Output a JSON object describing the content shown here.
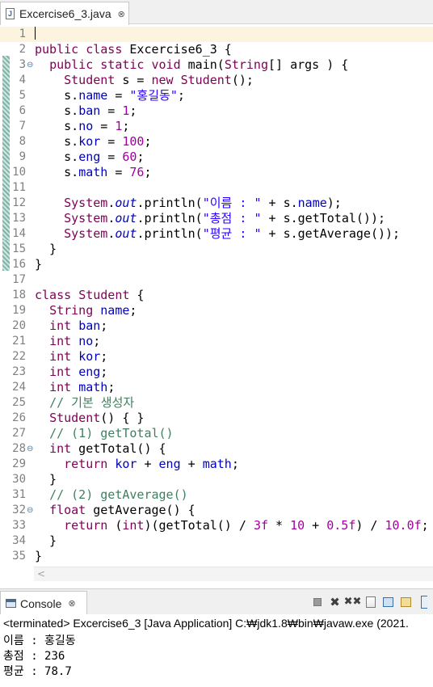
{
  "editor_tab": {
    "title": "Excercise6_3.java",
    "icon": "java-file-icon",
    "close": "⊗"
  },
  "editor": {
    "lines": [
      {
        "n": "1",
        "fold": "",
        "t": ""
      },
      {
        "n": "2",
        "fold": "",
        "t": "public class Excercise6_3 {"
      },
      {
        "n": "3",
        "fold": "⊖",
        "t": "  public static void main(String[] args ) {"
      },
      {
        "n": "4",
        "fold": "",
        "t": "    Student s = new Student();"
      },
      {
        "n": "5",
        "fold": "",
        "t": "    s.name = \"홍길동\";"
      },
      {
        "n": "6",
        "fold": "",
        "t": "    s.ban = 1;"
      },
      {
        "n": "7",
        "fold": "",
        "t": "    s.no = 1;"
      },
      {
        "n": "8",
        "fold": "",
        "t": "    s.kor = 100;"
      },
      {
        "n": "9",
        "fold": "",
        "t": "    s.eng = 60;"
      },
      {
        "n": "10",
        "fold": "",
        "t": "    s.math = 76;"
      },
      {
        "n": "11",
        "fold": "",
        "t": ""
      },
      {
        "n": "12",
        "fold": "",
        "t": "    System.out.println(\"이름 : \" + s.name);"
      },
      {
        "n": "13",
        "fold": "",
        "t": "    System.out.println(\"총점 : \" + s.getTotal());"
      },
      {
        "n": "14",
        "fold": "",
        "t": "    System.out.println(\"평균 : \" + s.getAverage());"
      },
      {
        "n": "15",
        "fold": "",
        "t": "  }"
      },
      {
        "n": "16",
        "fold": "",
        "t": "}"
      },
      {
        "n": "17",
        "fold": "",
        "t": ""
      },
      {
        "n": "18",
        "fold": "",
        "t": "class Student {"
      },
      {
        "n": "19",
        "fold": "",
        "t": "  String name;"
      },
      {
        "n": "20",
        "fold": "",
        "t": "  int ban;"
      },
      {
        "n": "21",
        "fold": "",
        "t": "  int no;"
      },
      {
        "n": "22",
        "fold": "",
        "t": "  int kor;"
      },
      {
        "n": "23",
        "fold": "",
        "t": "  int eng;"
      },
      {
        "n": "24",
        "fold": "",
        "t": "  int math;"
      },
      {
        "n": "25",
        "fold": "",
        "t": "  // 기본 생성자"
      },
      {
        "n": "26",
        "fold": "",
        "t": "  Student() { }"
      },
      {
        "n": "27",
        "fold": "",
        "t": "  // (1) getTotal()"
      },
      {
        "n": "28",
        "fold": "⊖",
        "t": "  int getTotal() {"
      },
      {
        "n": "29",
        "fold": "",
        "t": "    return kor + eng + math;"
      },
      {
        "n": "30",
        "fold": "",
        "t": "  }"
      },
      {
        "n": "31",
        "fold": "",
        "t": "  // (2) getAverage()"
      },
      {
        "n": "32",
        "fold": "⊖",
        "t": "  float getAverage() {"
      },
      {
        "n": "33",
        "fold": "",
        "t": "    return (int)(getTotal() / 3f * 10 + 0.5f) / 10.0f;"
      },
      {
        "n": "34",
        "fold": "",
        "t": "  }"
      },
      {
        "n": "35",
        "fold": "",
        "t": "}"
      }
    ],
    "scroll_left_glyph": "<"
  },
  "console": {
    "tab_title": "Console",
    "close": "⊗",
    "status": "<terminated> Excercise6_3 [Java Application] C:₩jdk1.8₩bin₩javaw.exe (2021.",
    "output": [
      "이름 : 홍길동",
      "총점 : 236",
      "평균 : 78.7"
    ],
    "tools": [
      "stop-icon",
      "remove-launch-icon",
      "remove-all-terminated-icon",
      "clear-console-icon",
      "scroll-lock-icon",
      "pin-console-icon",
      "display-console-icon"
    ]
  }
}
